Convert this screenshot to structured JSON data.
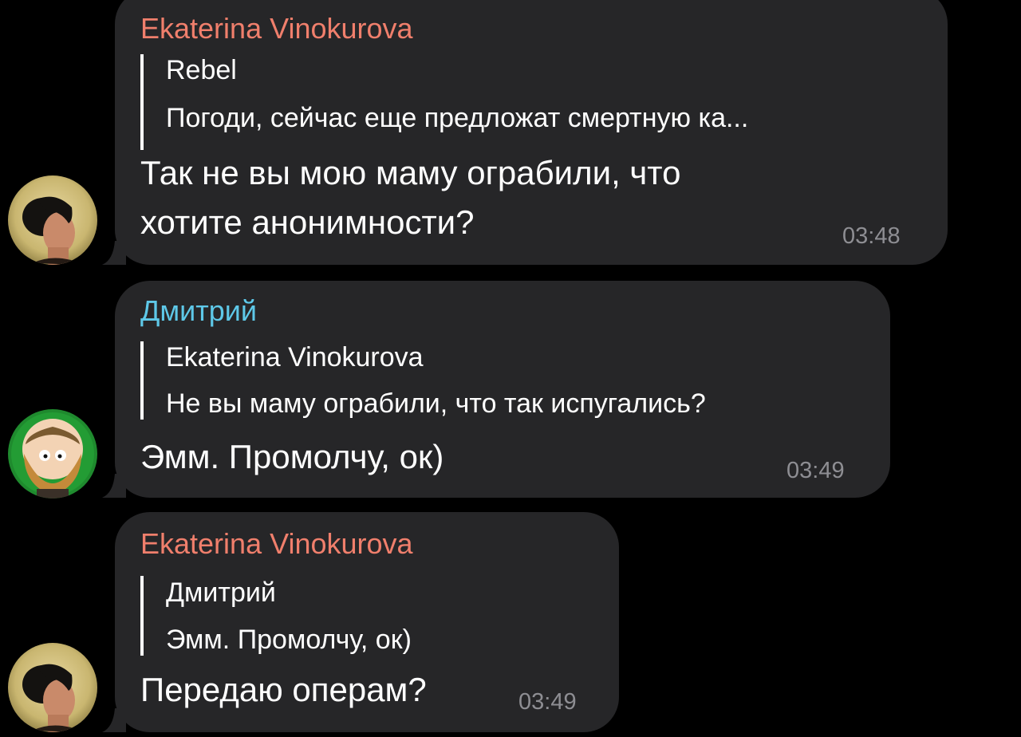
{
  "colors": {
    "background": "#000000",
    "bubble": "#262628",
    "name_ekaterina": "#f07f6c",
    "name_dmitriy": "#5ec8e8",
    "timestamp": "#8e8e93"
  },
  "messages": [
    {
      "sender": "Ekaterina Vinokurova",
      "avatar": "woman-portrait-avatar",
      "reply": {
        "name": "Rebel",
        "text": "Погоди, сейчас еще предложат смертную ка..."
      },
      "lines": [
        "Так не вы мою маму ограбили, что",
        "хотите анонимности?"
      ],
      "time": "03:48"
    },
    {
      "sender": "Дмитрий",
      "avatar": "cartoon-man-avatar",
      "reply": {
        "name": "Ekaterina Vinokurova",
        "text": "Не вы маму ограбили, что так испугались?"
      },
      "lines": [
        "Эмм. Промолчу, ок)"
      ],
      "time": "03:49"
    },
    {
      "sender": "Ekaterina Vinokurova",
      "avatar": "woman-portrait-avatar",
      "reply": {
        "name": "Дмитрий",
        "text": "Эмм. Промолчу, ок)"
      },
      "lines": [
        "Передаю операм?"
      ],
      "time": "03:49"
    }
  ]
}
